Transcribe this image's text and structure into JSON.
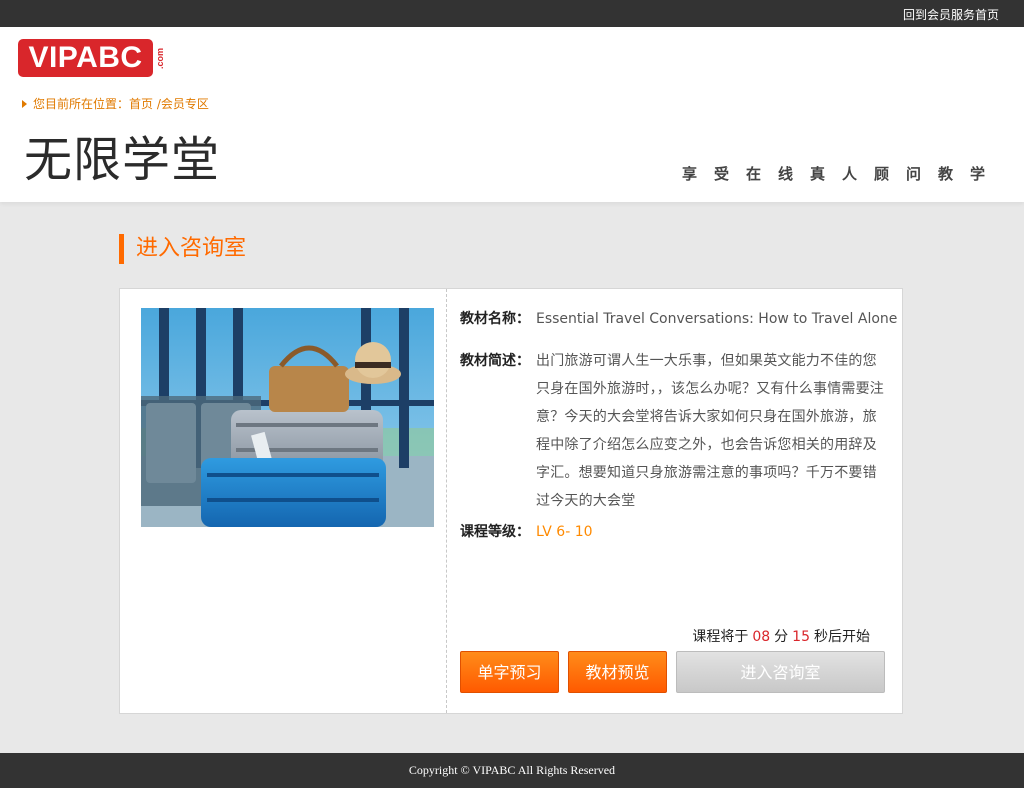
{
  "topbar": {
    "home_link": "回到会员服务首页"
  },
  "logo": {
    "text": "VIPABC",
    "suffix": ".com"
  },
  "breadcrumb": {
    "text": "您目前所在位置：首页 /会员专区"
  },
  "header": {
    "title": "无限学堂",
    "slogan": "享受在线真人顾问教学"
  },
  "section": {
    "title": "进入咨询室"
  },
  "course": {
    "name_label": "教材名称：",
    "name": "Essential Travel Conversations: How to Travel Alone",
    "desc_label": "教材简述：",
    "desc": "出门旅游可谓人生一大乐事，但如果英文能力不佳的您只身在国外旅游时，，该怎么办呢？又有什么事情需要注意？今天的大会堂将告诉大家如何只身在国外旅游，旅程中除了介绍怎么应变之外，也会告诉您相关的用辞及字汇。想要知道只身旅游需注意的事项吗？千万不要错过今天的大会堂",
    "level_label": "课程等级：",
    "level": "LV 6- 10"
  },
  "countdown": {
    "prefix": "课程将于",
    "minutes": "08",
    "minutes_unit": "分",
    "seconds": "15",
    "suffix": "秒后开始"
  },
  "buttons": {
    "vocab": "单字预习",
    "preview": "教材预览",
    "enter": "进入咨询室"
  },
  "footer": {
    "copyright": "Copyright © VIPABC All Rights Reserved"
  },
  "colors": {
    "accent": "#ff6a00",
    "brand": "#d9262b",
    "bar": "#333333",
    "level": "#ff8a00"
  },
  "icons": {
    "breadcrumb_marker": "triangle-right-icon",
    "photo": "travel-luggage-image"
  }
}
